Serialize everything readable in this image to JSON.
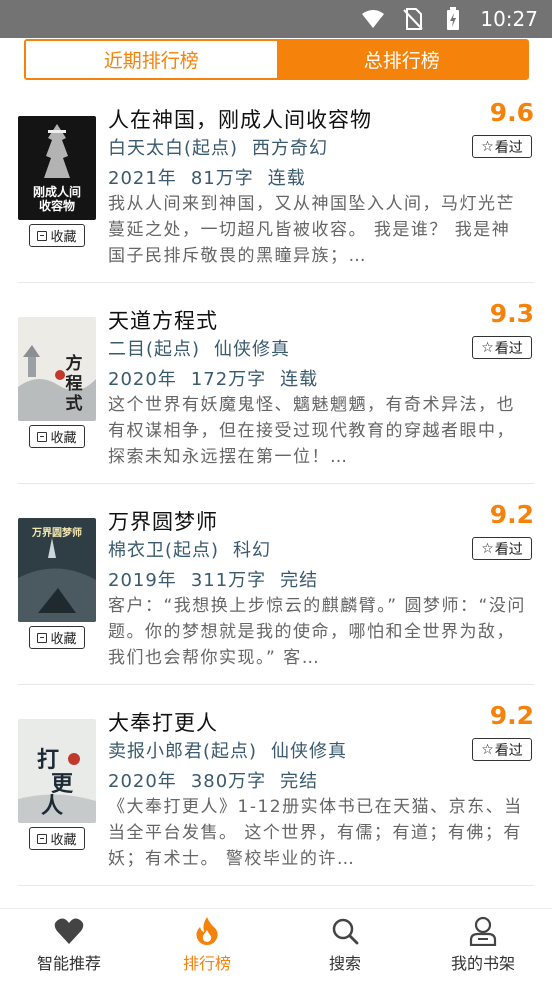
{
  "status_bar": {
    "time": "10:27"
  },
  "tabs": [
    {
      "label": "近期排行榜",
      "active": false
    },
    {
      "label": "总排行榜",
      "active": true
    }
  ],
  "actions": {
    "collect_label": "收藏",
    "seen_label": "看过"
  },
  "books": [
    {
      "title": "人在神国，刚成人间收容物",
      "score": "9.6",
      "author": "白天太白(起点)",
      "genre": "西方奇幻",
      "year": "2021年",
      "words": "81万字",
      "status": "连载",
      "desc": "我从人间来到神国，又从神国坠入人间，马灯光芒蔓延之处，一切超凡皆被收容。 我是谁？ 我是神国子民排斥敬畏的黑瞳异族；…",
      "cover_text": "刚成人间收容物",
      "cover_color": "#1a1a1a"
    },
    {
      "title": "天道方程式",
      "score": "9.3",
      "author": "二目(起点)",
      "genre": "仙侠修真",
      "year": "2020年",
      "words": "172万字",
      "status": "连载",
      "desc": "这个世界有妖魔鬼怪、魑魅魍魉，有奇术异法，也有权谋相争，但在接受过现代教育的穿越者眼中，探索未知永远摆在第一位！…",
      "cover_text": "方程式",
      "cover_color": "#e9e6df"
    },
    {
      "title": "万界圆梦师",
      "score": "9.2",
      "author": "棉衣卫(起点)",
      "genre": "科幻",
      "year": "2019年",
      "words": "311万字",
      "status": "完结",
      "desc": "客户：“我想换上步惊云的麒麟臂。” 圆梦师：“没问题。你的梦想就是我的使命，哪怕和全世界为敌，我们也会帮你实现。” 客…",
      "cover_text": "万界圆梦师",
      "cover_color": "#3a4a52"
    },
    {
      "title": "大奉打更人",
      "score": "9.2",
      "author": "卖报小郎君(起点)",
      "genre": "仙侠修真",
      "year": "2020年",
      "words": "380万字",
      "status": "完结",
      "desc": "《大奉打更人》1-12册实体书已在天猫、京东、当当全平台发售。 这个世界，有儒；有道；有佛；有妖；有术士。 警校毕业的许…",
      "cover_text": "打更人",
      "cover_color": "#e4e6e4"
    }
  ],
  "bottom_nav": [
    {
      "label": "智能推荐",
      "icon": "heart-icon",
      "active": false
    },
    {
      "label": "排行榜",
      "icon": "flame-icon",
      "active": true
    },
    {
      "label": "搜索",
      "icon": "search-icon",
      "active": false
    },
    {
      "label": "我的书架",
      "icon": "user-icon",
      "active": false
    }
  ]
}
